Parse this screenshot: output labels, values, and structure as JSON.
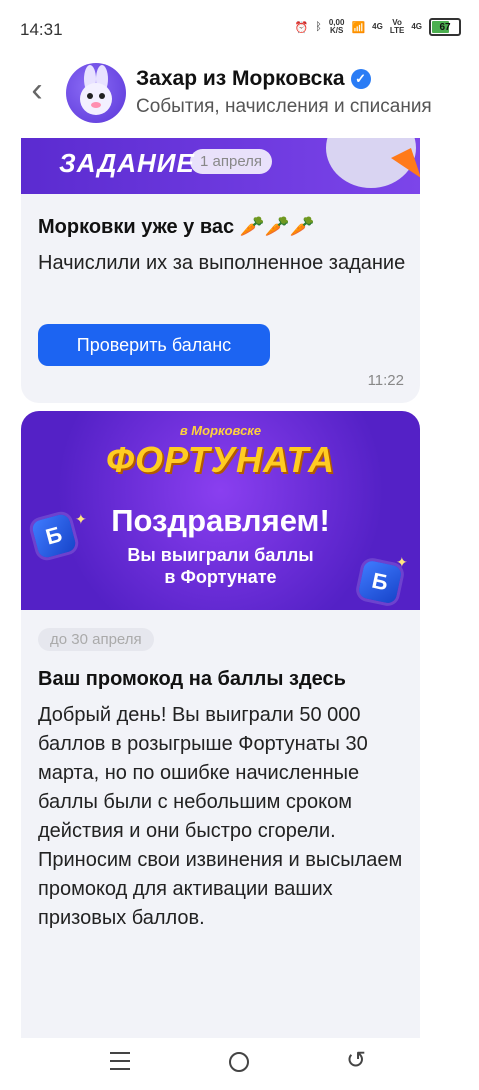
{
  "status": {
    "time": "14:31",
    "speed_value": "0,00",
    "speed_unit": "K/S",
    "net1": "4G",
    "volte1": "Vo",
    "volte2": "LTE",
    "net2": "4G",
    "battery": "67"
  },
  "header": {
    "title": "Захар из Морковска",
    "subtitle": "События, начисления и списания"
  },
  "messages": [
    {
      "banner_text": "ЗАДАНИЕ",
      "date": "1 апреля",
      "title": "Морковки уже у вас 🥕🥕🥕",
      "text": "Начислили их за выполненное задание",
      "button": "Проверить баланс",
      "time": "11:22"
    },
    {
      "banner_small": "в Морковске",
      "banner_brand": "ФОРТУНАТА",
      "banner_congrats": "Поздравляем!",
      "banner_sub_line1": "Вы выиграли баллы",
      "banner_sub_line2": "в Фортунате",
      "cube_letter": "Б",
      "date": "до 30 апреля",
      "title": "Ваш промокод на баллы здесь",
      "text": "Добрый день! Вы выиграли 50 000 баллов в розыгрыше Фортунаты 30 марта, но по ошибке начисленные баллы были с небольшим сроком действия и они быстро сгорели. Приносим свои извинения и высылаем промокод для активации ваших призовых баллов."
    }
  ],
  "colors": {
    "accent_button": "#1c64f2",
    "banner_purple": "#6a33e0",
    "card_bg": "#f2f3f8"
  }
}
